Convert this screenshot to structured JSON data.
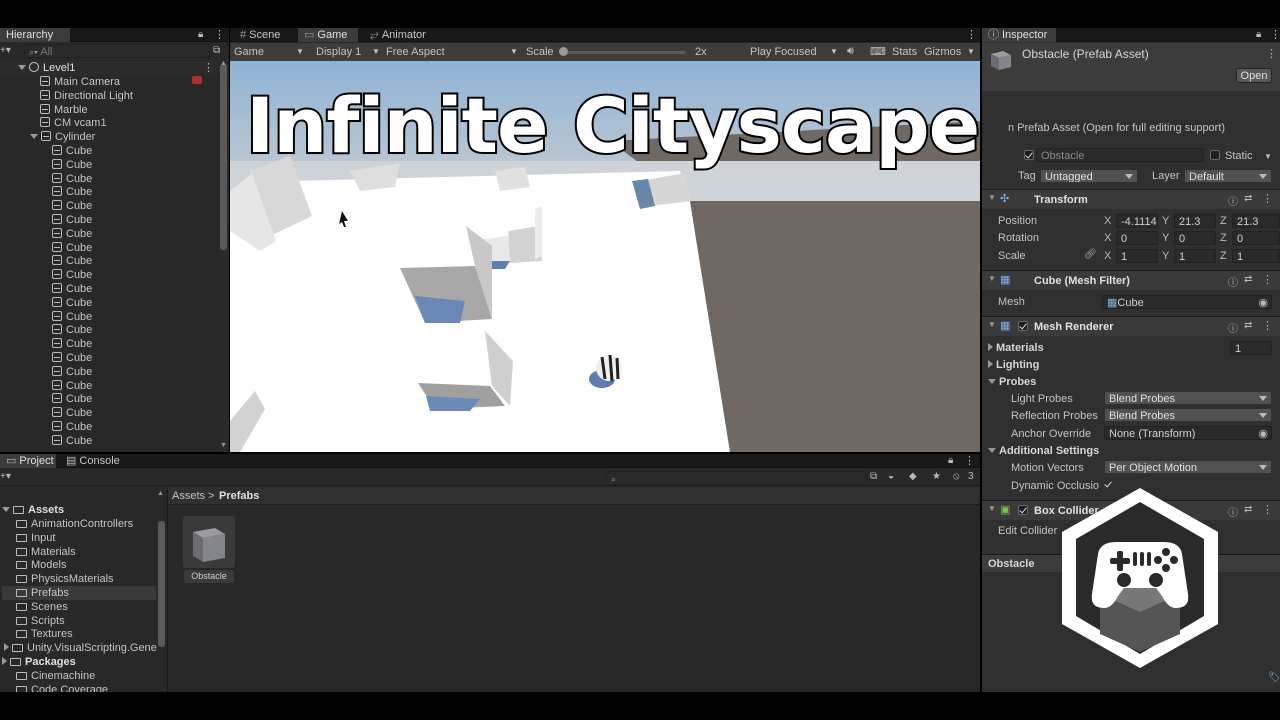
{
  "hierarchy": {
    "tab": "Hierarchy",
    "search_placeholder": "All",
    "scene": "Level1",
    "items": [
      "Main Camera",
      "Directional Light",
      "Marble",
      "CM vcam1",
      "Cylinder"
    ],
    "cube_label": "Cube",
    "cube_count": 22
  },
  "gameview": {
    "tabs": [
      "Scene",
      "Game",
      "Animator"
    ],
    "game_dd": "Game",
    "display_dd": "Display 1",
    "aspect_dd": "Free Aspect",
    "scale_label": "Scale",
    "scale_value": "2x",
    "play_focused": "Play Focused",
    "stats": "Stats",
    "gizmos": "Gizmos",
    "overlay_title": "Infinite Cityscape"
  },
  "project": {
    "tabs": [
      "Project",
      "Console"
    ],
    "breadcrumb_root": "Assets",
    "breadcrumb_sep": ">",
    "breadcrumb_current": "Prefabs",
    "hidden_count": "3",
    "tree_assets": "Assets",
    "tree_items": [
      "AnimationControllers",
      "Input",
      "Materials",
      "Models",
      "PhysicsMaterials",
      "Prefabs",
      "Scenes",
      "Scripts",
      "Textures",
      "Unity.VisualScripting.Gene"
    ],
    "tree_packages": "Packages",
    "package_items": [
      "Cinemachine",
      "Code Coverage"
    ],
    "asset_name": "Obstacle"
  },
  "inspector": {
    "tab": "Inspector",
    "title": "Obstacle (Prefab Asset)",
    "open_button": "Open",
    "prefab_note": "n Prefab Asset (Open for full editing support)",
    "object_name": "Obstacle",
    "static_label": "Static",
    "tag_label": "Tag",
    "tag_value": "Untagged",
    "layer_label": "Layer",
    "layer_value": "Default",
    "transform": {
      "title": "Transform",
      "position_label": "Position",
      "rotation_label": "Rotation",
      "scale_label": "Scale",
      "position": [
        "-4.1114",
        "21.3",
        "21.3"
      ],
      "rotation": [
        "0",
        "0",
        "0"
      ],
      "scale": [
        "1",
        "1",
        "1"
      ],
      "axes": [
        "X",
        "Y",
        "Z"
      ]
    },
    "mesh_filter": {
      "title": "Cube (Mesh Filter)",
      "mesh_label": "Mesh",
      "mesh_value": "Cube"
    },
    "mesh_renderer": {
      "title": "Mesh Renderer",
      "materials_label": "Materials",
      "materials_count": "1",
      "lighting_label": "Lighting",
      "probes_label": "Probes",
      "light_probes_label": "Light Probes",
      "light_probes_value": "Blend Probes",
      "reflection_probes_label": "Reflection Probes",
      "reflection_probes_value": "Blend Probes",
      "anchor_override_label": "Anchor Override",
      "anchor_override_value": "None (Transform)",
      "additional_label": "Additional Settings",
      "motion_vectors_label": "Motion Vectors",
      "motion_vectors_value": "Per Object Motion",
      "dynamic_occlusion_label": "Dynamic Occlusio"
    },
    "box_collider": {
      "title": "Box Collider",
      "edit_label": "Edit Collider"
    },
    "footer_label": "Obstacle"
  }
}
